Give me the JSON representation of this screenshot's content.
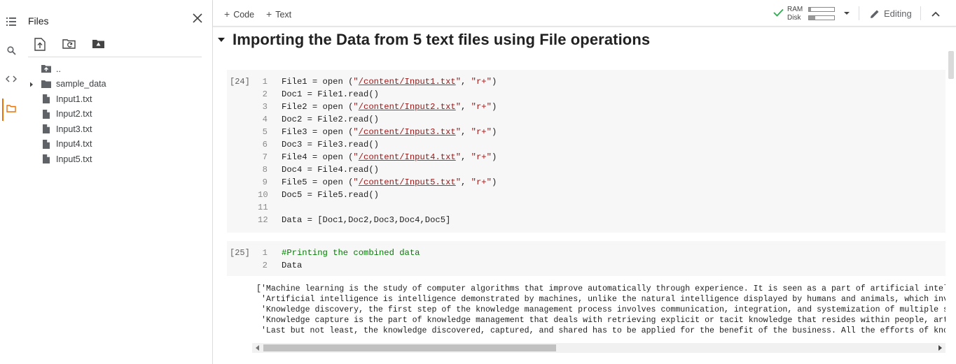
{
  "rail": {
    "icons": [
      "table-of-contents-icon",
      "search-icon",
      "code-snippets-icon",
      "files-folder-icon"
    ]
  },
  "files_panel": {
    "title": "Files",
    "toolbar": [
      "upload-file-icon",
      "refresh-icon",
      "mount-drive-icon"
    ],
    "tree": [
      {
        "label": "..",
        "type": "parent-folder"
      },
      {
        "label": "sample_data",
        "type": "folder",
        "expandable": true
      },
      {
        "label": "Input1.txt",
        "type": "file"
      },
      {
        "label": "Input2.txt",
        "type": "file"
      },
      {
        "label": "Input3.txt",
        "type": "file"
      },
      {
        "label": "Input4.txt",
        "type": "file"
      },
      {
        "label": "Input5.txt",
        "type": "file"
      }
    ]
  },
  "toolbar": {
    "add_code": "Code",
    "add_text": "Text",
    "ram_label": "RAM",
    "disk_label": "Disk",
    "ram_usage": 0.08,
    "disk_usage": 0.25,
    "editing": "Editing",
    "connected_color": "#34a853"
  },
  "notebook": {
    "heading": "Importing the Data from 5 text files using File operations",
    "cells": [
      {
        "exec": "[24]",
        "lines": [
          {
            "n": "1",
            "parts": [
              [
                "ct",
                "File1 = open ("
              ],
              [
                "str",
                "\""
              ],
              [
                "path",
                "/content/Input1.txt"
              ],
              [
                "str",
                "\""
              ],
              [
                "ct",
                ", "
              ],
              [
                "str",
                "\"r+\""
              ],
              [
                "ct",
                ")"
              ]
            ]
          },
          {
            "n": "2",
            "parts": [
              [
                "ct",
                "Doc1 = File1.read()"
              ]
            ]
          },
          {
            "n": "3",
            "parts": [
              [
                "ct",
                "File2 = open ("
              ],
              [
                "str",
                "\""
              ],
              [
                "path",
                "/content/Input2.txt"
              ],
              [
                "str",
                "\""
              ],
              [
                "ct",
                ", "
              ],
              [
                "str",
                "\"r+\""
              ],
              [
                "ct",
                ")"
              ]
            ]
          },
          {
            "n": "4",
            "parts": [
              [
                "ct",
                "Doc2 = File2.read()"
              ]
            ]
          },
          {
            "n": "5",
            "parts": [
              [
                "ct",
                "File3 = open ("
              ],
              [
                "str",
                "\""
              ],
              [
                "path",
                "/content/Input3.txt"
              ],
              [
                "str",
                "\""
              ],
              [
                "ct",
                ", "
              ],
              [
                "str",
                "\"r+\""
              ],
              [
                "ct",
                ")"
              ]
            ]
          },
          {
            "n": "6",
            "parts": [
              [
                "ct",
                "Doc3 = File3.read()"
              ]
            ]
          },
          {
            "n": "7",
            "parts": [
              [
                "ct",
                "File4 = open ("
              ],
              [
                "str",
                "\""
              ],
              [
                "path",
                "/content/Input4.txt"
              ],
              [
                "str",
                "\""
              ],
              [
                "ct",
                ", "
              ],
              [
                "str",
                "\"r+\""
              ],
              [
                "ct",
                ")"
              ]
            ]
          },
          {
            "n": "8",
            "parts": [
              [
                "ct",
                "Doc4 = File4.read()"
              ]
            ]
          },
          {
            "n": "9",
            "parts": [
              [
                "ct",
                "File5 = open ("
              ],
              [
                "str",
                "\""
              ],
              [
                "path",
                "/content/Input5.txt"
              ],
              [
                "str",
                "\""
              ],
              [
                "ct",
                ", "
              ],
              [
                "str",
                "\"r+\""
              ],
              [
                "ct",
                ")"
              ]
            ]
          },
          {
            "n": "10",
            "parts": [
              [
                "ct",
                "Doc5 = File5.read()"
              ]
            ]
          },
          {
            "n": "11",
            "parts": [
              [
                "ct",
                ""
              ]
            ]
          },
          {
            "n": "12",
            "parts": [
              [
                "ct",
                "Data = [Doc1,Doc2,Doc3,Doc4,Doc5]"
              ]
            ]
          }
        ]
      },
      {
        "exec": "[25]",
        "lines": [
          {
            "n": "1",
            "parts": [
              [
                "cmt",
                "#Printing the combined data"
              ]
            ]
          },
          {
            "n": "2",
            "parts": [
              [
                "ct",
                "Data"
              ]
            ]
          }
        ]
      }
    ],
    "output": [
      "['Machine learning is the study of computer algorithms that improve automatically through experience. It is seen as a part of artificial intelligence.",
      " 'Artificial intelligence is intelligence demonstrated by machines, unlike the natural intelligence displayed by humans and animals, which involves",
      " 'Knowledge discovery, the first step of the knowledge management process involves communication, integration, and systemization of multiple streams",
      " 'Knowledge capture is the part of knowledge management that deals with retrieving explicit or tacit knowledge that resides within people, artifacts",
      " 'Last but not least, the knowledge discovered, captured, and shared has to be applied for the benefit of the business. All the efforts of knowledge"
    ],
    "output_scroll_position": 0.42
  }
}
